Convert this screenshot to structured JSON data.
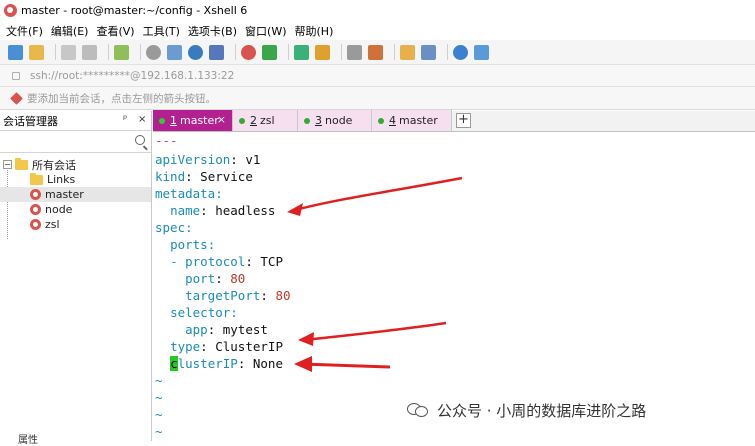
{
  "window": {
    "title": "master - root@master:~/config - Xshell 6"
  },
  "menu": [
    "文件(F)",
    "编辑(E)",
    "查看(V)",
    "工具(T)",
    "选项卡(B)",
    "窗口(W)",
    "帮助(H)"
  ],
  "address": {
    "text": "ssh://root:*********@192.168.1.133:22"
  },
  "hint": {
    "text": "要添加当前会话，点击左侧的箭头按钮。"
  },
  "sidebar": {
    "title": "会话管理器",
    "pin_label": "ᵖ",
    "close_label": "×",
    "root_label": "所有会话",
    "root_toggle": "−",
    "items": [
      {
        "label": "Links",
        "type": "folder"
      },
      {
        "label": "master",
        "type": "session"
      },
      {
        "label": "node",
        "type": "session"
      },
      {
        "label": "zsl",
        "type": "session"
      }
    ],
    "bottom_label": "属性"
  },
  "tabs": [
    {
      "num": "1",
      "label": "master",
      "active": true
    },
    {
      "num": "2",
      "label": "zsl",
      "active": false
    },
    {
      "num": "3",
      "label": "node",
      "active": false
    },
    {
      "num": "4",
      "label": "master",
      "active": false
    }
  ],
  "tab_add": "+",
  "tab_close": "×",
  "terminal": {
    "separator": "---",
    "lines": {
      "l1k": "apiVersion",
      "l1v": "v1",
      "l2k": "kind",
      "l2v": "Service",
      "l3k": "metadata",
      "l4k": "name",
      "l4v": "headless",
      "l5k": "spec",
      "l6k": "ports",
      "l7k": "protocol",
      "l7v": "TCP",
      "l8k": "port",
      "l8v": "80",
      "l9k": "targetPort",
      "l9v": "80",
      "l10k": "selector",
      "l11k": "app",
      "l11v": "mytest",
      "l12k": "type",
      "l12v": "ClusterIP",
      "l13cursor": "c",
      "l13k": "lusterIP",
      "l13v": "None"
    },
    "tilde": "~"
  },
  "watermark": {
    "text": "公众号 · 小周的数据库进阶之路"
  },
  "colors": {
    "accent": "#b3208f",
    "arrow": "#e02020",
    "key": "#1a8cb8",
    "number": "#c0392b"
  }
}
